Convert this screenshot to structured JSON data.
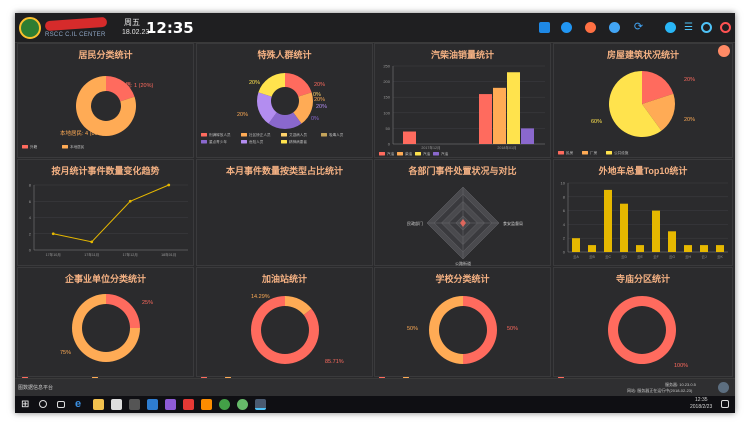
{
  "header": {
    "brand_sub": "RSCC C.IL CENTER",
    "weekday": "周五",
    "date": "18.02.23",
    "time": "12:35",
    "icons": [
      "map-icon",
      "globe-icon",
      "pie-icon",
      "tools-icon",
      "refresh-icon",
      "user-icon",
      "menu-icon",
      "circle-icon",
      "power-icon"
    ]
  },
  "colors": {
    "bg": "#2a2a2c",
    "title": "#f4b183",
    "red": "#ff6b5e",
    "orange": "#ffab55",
    "yellow": "#ffe34d",
    "purple": "#8a68cd",
    "gold": "#e6b800",
    "line": "#e6b800"
  },
  "panels": [
    {
      "title": "居民分类统计"
    },
    {
      "title": "特殊人群统计"
    },
    {
      "title": "汽柴油销量统计"
    },
    {
      "title": "房屋建筑状况统计"
    },
    {
      "title": "按月统计事件数量变化趋势"
    },
    {
      "title": "本月事件数量按类型占比统计"
    },
    {
      "title": "各部门事件处置状况与对比"
    },
    {
      "title": "外地车总量Top10统计"
    },
    {
      "title": "企事业单位分类统计"
    },
    {
      "title": "加油站统计"
    },
    {
      "title": "学校分类统计"
    },
    {
      "title": "寺庙分区统计"
    }
  ],
  "chart_data": [
    {
      "type": "pie",
      "title": "居民分类统计",
      "slices": [
        {
          "label": "外籍",
          "value": 1,
          "pct": "20%",
          "color": "#ff6b5e"
        },
        {
          "label": "本地居民",
          "value": 4,
          "pct": "80%",
          "color": "#ffab55"
        }
      ],
      "labels": [
        "外籍: 1 (20%)",
        "本地居民: 4 (80%)"
      ],
      "legend": [
        "外籍",
        "本地居民"
      ]
    },
    {
      "type": "pie",
      "title": "特殊人群统计",
      "slices": [
        {
          "label": "刑满释放人员",
          "value": 20,
          "color": "#ff6b5e"
        },
        {
          "label": "社区矫正人员",
          "value": 20,
          "color": "#ffab55"
        },
        {
          "label": "艾滋病人员",
          "value": 0,
          "color": "#ffd36b"
        },
        {
          "label": "吸毒人员",
          "value": 0,
          "color": "#c4a35a"
        },
        {
          "label": "重点青少年",
          "value": 20,
          "color": "#8a68cd"
        },
        {
          "label": "危险人员",
          "value": 20,
          "color": "#b38df0"
        },
        {
          "label": "精神病患者",
          "value": 20,
          "color": "#ffe34d"
        }
      ],
      "labels": [
        "20%",
        "20%",
        "0%",
        "0%",
        "20%",
        "20%",
        "20%"
      ],
      "legend": [
        "刑满释放人员",
        "社区矫正人员",
        "艾滋病人员",
        "吸毒人员",
        "重点青少年",
        "危险人员",
        "精神病患者"
      ]
    },
    {
      "type": "bar",
      "title": "汽柴油销量统计",
      "categories": [
        "2017年12月",
        "2018年01月"
      ],
      "series": [
        {
          "name": "汽油",
          "values": [
            40,
            160
          ],
          "color": "#ff6b5e"
        },
        {
          "name": "柴油",
          "values": [
            0,
            180
          ],
          "color": "#ffab55"
        },
        {
          "name": "汽油",
          "values": [
            0,
            230
          ],
          "color": "#ffe34d"
        },
        {
          "name": "汽油",
          "values": [
            0,
            50
          ],
          "color": "#8a68cd"
        }
      ],
      "yticks": [
        "0",
        "50",
        "100",
        "150",
        "200",
        "250"
      ],
      "ylim": [
        0,
        250
      ]
    },
    {
      "type": "pie",
      "title": "房屋建筑状况统计",
      "slices": [
        {
          "label": "民房",
          "value": 20,
          "color": "#ff6b5e"
        },
        {
          "label": "厂房",
          "value": 20,
          "color": "#ffab55"
        },
        {
          "label": "公共设施",
          "value": 60,
          "color": "#ffe34d"
        }
      ],
      "labels": [
        "20%",
        "20%",
        "60%"
      ],
      "legend": [
        "民房",
        "厂房",
        "公共设施"
      ]
    },
    {
      "type": "line",
      "title": "按月统计事件数量变化趋势",
      "categories": [
        "17年10月",
        "17年11月",
        "17年12月",
        "18年01月"
      ],
      "values": [
        2,
        1,
        6,
        8
      ],
      "yticks": [
        "0",
        "2",
        "4",
        "6",
        "8"
      ],
      "ylim": [
        0,
        8
      ]
    },
    {
      "type": "pie",
      "title": "本月事件数量按类型占比统计",
      "slices": []
    },
    {
      "type": "radar",
      "title": "各部门事件处置状况与对比",
      "indicators": [
        "",
        "食安监督局",
        "公路街道",
        "民政部门"
      ]
    },
    {
      "type": "bar",
      "title": "外地车总量Top10统计",
      "categories": [
        "云A",
        "云B",
        "云C",
        "云D",
        "云E",
        "云F",
        "云G",
        "云H",
        "云J",
        "云K"
      ],
      "values": [
        2,
        1,
        9,
        7,
        1,
        6,
        3,
        1,
        1,
        1
      ],
      "yticks": [
        "0",
        "2",
        "4",
        "6",
        "8",
        "10"
      ],
      "ylim": [
        0,
        10
      ]
    },
    {
      "type": "pie",
      "title": "企事业单位分类统计",
      "slices": [
        {
          "label": "",
          "value": 25,
          "color": "#ff6b5e"
        },
        {
          "label": "",
          "value": 75,
          "color": "#ffab55"
        }
      ],
      "labels": [
        "25%",
        "75%"
      ]
    },
    {
      "type": "pie",
      "title": "加油站统计",
      "slices": [
        {
          "label": "",
          "value": 14.29,
          "color": "#ffab55"
        },
        {
          "label": "",
          "value": 85.71,
          "color": "#ff6b5e"
        }
      ],
      "labels": [
        "14.29%",
        "85.71%"
      ]
    },
    {
      "type": "pie",
      "title": "学校分类统计",
      "slices": [
        {
          "label": "",
          "value": 50,
          "color": "#ff6b5e"
        },
        {
          "label": "",
          "value": 50,
          "color": "#ffab55"
        }
      ],
      "labels": [
        "50%",
        "50%"
      ]
    },
    {
      "type": "pie",
      "title": "寺庙分区统计",
      "slices": [
        {
          "label": "",
          "value": 100,
          "color": "#ff6b5e"
        }
      ],
      "labels": [
        "100%"
      ]
    }
  ],
  "statusbar": {
    "left": "图数据信息平台",
    "right1": "服务器: 10.23.0.5",
    "right2": "网站: 服务器正在运行中(2018-02-23)"
  },
  "taskbar": {
    "time": "12:35",
    "date": "2018/2/23"
  }
}
